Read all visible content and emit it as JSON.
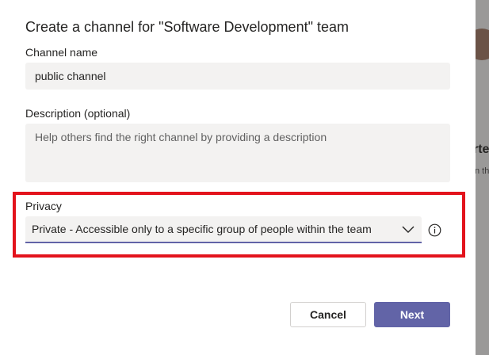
{
  "dialog": {
    "title": "Create a channel for \"Software Development\" team",
    "channel_name": {
      "label": "Channel name",
      "value": "public channel"
    },
    "description": {
      "label": "Description (optional)",
      "placeholder": "Help others find the right channel by providing a description"
    },
    "privacy": {
      "label": "Privacy",
      "selected": "Private - Accessible only to a specific group of people within the team"
    },
    "buttons": {
      "cancel": "Cancel",
      "next": "Next"
    }
  },
  "background": {
    "partial_heading": "rte",
    "partial_text": "n th"
  },
  "icons": {
    "dropdown": "chevron-down-icon",
    "info": "info-icon"
  },
  "colors": {
    "accent": "#6264a7",
    "highlight": "#e3131c",
    "field_bg": "#f3f2f1"
  }
}
